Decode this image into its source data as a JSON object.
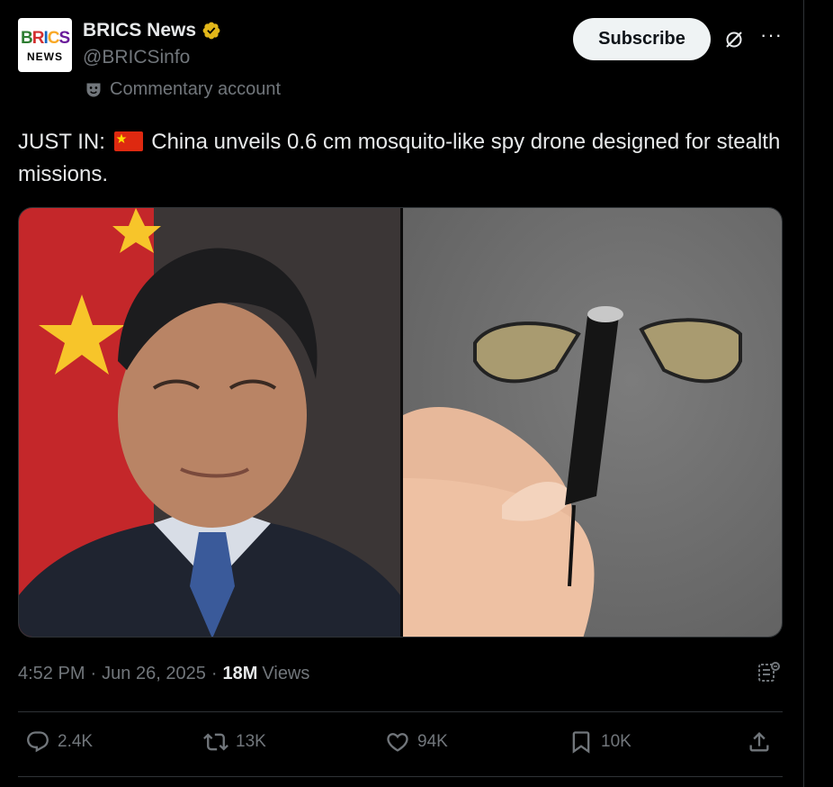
{
  "account": {
    "avatar_top": "BRICS",
    "avatar_bottom": "NEWS",
    "display_name": "BRICS News",
    "handle": "@BRICSinfo",
    "label": "Commentary account"
  },
  "header_actions": {
    "subscribe_label": "Subscribe"
  },
  "tweet": {
    "text_prefix": "JUST IN:",
    "text_body": "China unveils 0.6 cm mosquito-like spy drone designed for stealth missions."
  },
  "media": {
    "left_description_icon": "photo",
    "right_description_icon": "photo"
  },
  "meta": {
    "time": "4:52 PM",
    "date": "Jun 26, 2025",
    "views_count": "18M",
    "views_label": "Views"
  },
  "actions": {
    "replies": "2.4K",
    "reposts": "13K",
    "likes": "94K",
    "bookmarks": "10K"
  },
  "colors": {
    "background": "#000000",
    "text": "#e7e9ea",
    "muted": "#71767b",
    "verified": "#e2b719",
    "border": "#2f3336"
  }
}
